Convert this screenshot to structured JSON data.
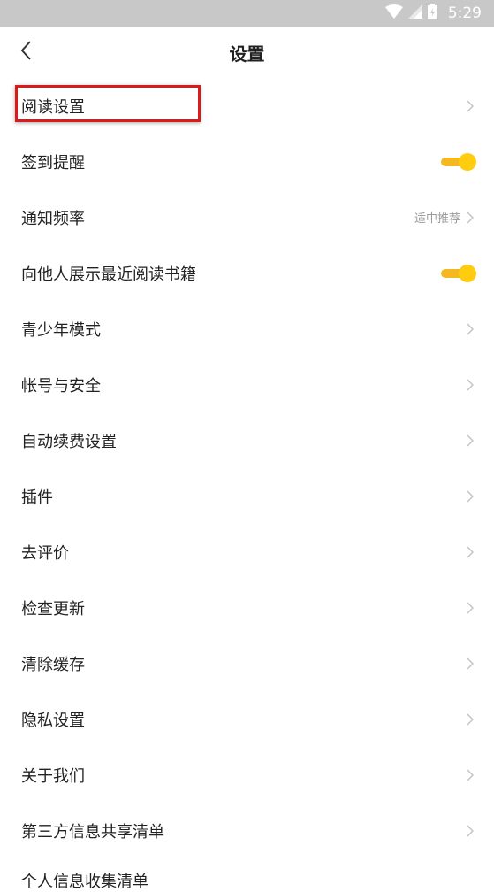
{
  "status_bar": {
    "time": "5:29"
  },
  "header": {
    "title": "设置"
  },
  "settings": [
    {
      "label": "阅读设置",
      "control": "chevron"
    },
    {
      "label": "签到提醒",
      "control": "toggle",
      "on": true
    },
    {
      "label": "通知频率",
      "control": "chevron",
      "value": "适中推荐"
    },
    {
      "label": "向他人展示最近阅读书籍",
      "control": "toggle",
      "on": true
    },
    {
      "label": "青少年模式",
      "control": "chevron"
    },
    {
      "label": "帐号与安全",
      "control": "chevron"
    },
    {
      "label": "自动续费设置",
      "control": "chevron"
    },
    {
      "label": "插件",
      "control": "chevron"
    },
    {
      "label": "去评价",
      "control": "chevron"
    },
    {
      "label": "检查更新",
      "control": "chevron"
    },
    {
      "label": "清除缓存",
      "control": "chevron"
    },
    {
      "label": "隐私设置",
      "control": "chevron"
    },
    {
      "label": "关于我们",
      "control": "chevron"
    },
    {
      "label": "第三方信息共享清单",
      "control": "chevron"
    }
  ],
  "cutoff_item": {
    "label": "个人信息收集清单"
  },
  "colors": {
    "accent": "#ffcc10",
    "status_bar": "#c8c8c8",
    "highlight": "#dd1a1a"
  }
}
